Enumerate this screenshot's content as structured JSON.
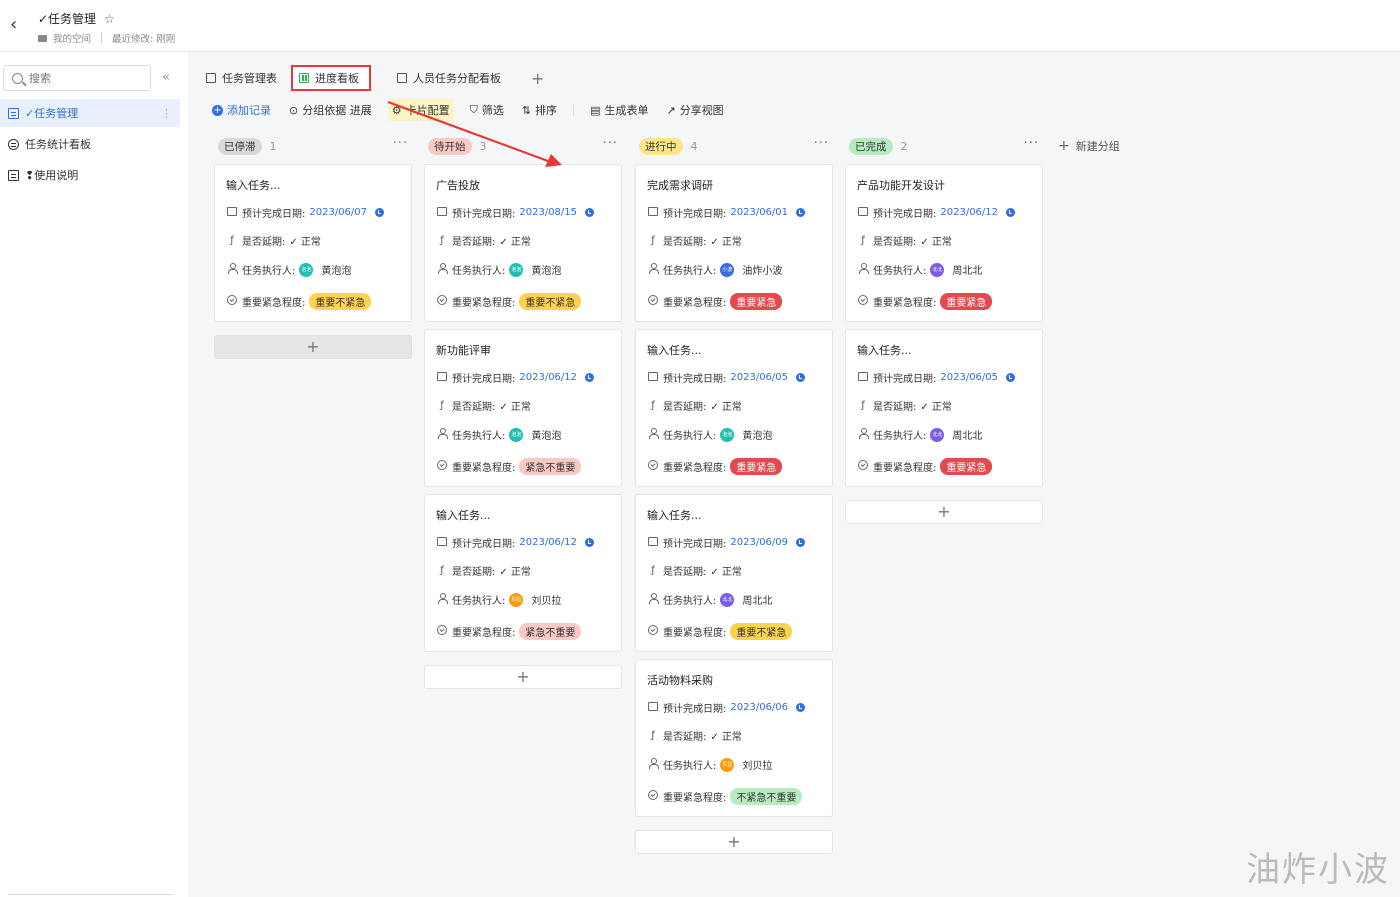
{
  "header": {
    "back": "‹",
    "title": "✓任务管理",
    "star": "☆",
    "space": "我的空间",
    "modified": "最近修改: 刚刚"
  },
  "sidebar": {
    "search_placeholder": "搜索",
    "collapse": "«",
    "items": [
      {
        "label": "✓任务管理",
        "icon": "table-icon",
        "active": true
      },
      {
        "label": "任务统计看板",
        "icon": "dashboard-icon",
        "active": false
      },
      {
        "label": "❢使用说明",
        "icon": "doc-icon",
        "active": false
      }
    ],
    "more": "⋮"
  },
  "tabs": [
    {
      "label": "任务管理表",
      "icon": "table-icon",
      "active": false
    },
    {
      "label": "进度看板",
      "icon": "kanban-icon",
      "active": true
    },
    {
      "label": "人员任务分配看板",
      "icon": "kanban-icon",
      "active": false
    }
  ],
  "tab_add": "+",
  "toolbar": {
    "add_record": "添加记录",
    "group_by": "分组依据 进展",
    "card_config": "卡片配置",
    "filter": "筛选",
    "sort": "排序",
    "form": "生成表单",
    "share": "分享视图"
  },
  "new_group": "新建分组",
  "field_labels": {
    "date": "预计完成日期:",
    "delay": "是否延期:",
    "owner": "任务执行人:",
    "priority": "重要紧急程度:"
  },
  "colors": {
    "accent": "#2f6de1",
    "annotation": "#e53935"
  },
  "columns": [
    {
      "status": "已停滞",
      "count": "1",
      "bg": "#d9d9d9",
      "fg": "#333",
      "cards": [
        {
          "title": "输入任务...",
          "date": "2023/06/07",
          "delay": "✓ 正常",
          "owner": "黄泡泡",
          "owner_short": "泡泡",
          "owner_color": "#1fc0b2",
          "priority": "重要不紧急",
          "pri_bg": "#fcd34d",
          "pri_fg": "#333"
        }
      ],
      "add": "+"
    },
    {
      "status": "待开始",
      "count": "3",
      "bg": "#f9c9c6",
      "fg": "#333",
      "cards": [
        {
          "title": "广告投放",
          "date": "2023/08/15",
          "delay": "✓ 正常",
          "owner": "黄泡泡",
          "owner_short": "泡泡",
          "owner_color": "#1fc0b2",
          "priority": "重要不紧急",
          "pri_bg": "#fcd34d",
          "pri_fg": "#333"
        },
        {
          "title": "新功能评审",
          "date": "2023/06/12",
          "delay": "✓ 正常",
          "owner": "黄泡泡",
          "owner_short": "泡泡",
          "owner_color": "#1fc0b2",
          "priority": "紧急不重要",
          "pri_bg": "#f9c9c6",
          "pri_fg": "#333"
        },
        {
          "title": "输入任务...",
          "date": "2023/06/12",
          "delay": "✓ 正常",
          "owner": "刘贝拉",
          "owner_short": "贝拉",
          "owner_color": "#f59e0b",
          "priority": "紧急不重要",
          "pri_bg": "#f9c9c6",
          "pri_fg": "#333"
        }
      ],
      "add": "+"
    },
    {
      "status": "进行中",
      "count": "4",
      "bg": "#fde68a",
      "fg": "#333",
      "cards": [
        {
          "title": "完成需求调研",
          "date": "2023/06/01",
          "delay": "✓ 正常",
          "owner": "油炸小波",
          "owner_short": "小波",
          "owner_color": "#3b6de0",
          "priority": "重要紧急",
          "pri_bg": "#e5484d",
          "pri_fg": "#fff"
        },
        {
          "title": "输入任务...",
          "date": "2023/06/05",
          "delay": "✓ 正常",
          "owner": "黄泡泡",
          "owner_short": "泡泡",
          "owner_color": "#1fc0b2",
          "priority": "重要紧急",
          "pri_bg": "#e5484d",
          "pri_fg": "#fff"
        },
        {
          "title": "输入任务...",
          "date": "2023/06/09",
          "delay": "✓ 正常",
          "owner": "周北北",
          "owner_short": "北北",
          "owner_color": "#7c5ce0",
          "priority": "重要不紧急",
          "pri_bg": "#fcd34d",
          "pri_fg": "#333"
        },
        {
          "title": "活动物料采购",
          "date": "2023/06/06",
          "delay": "✓ 正常",
          "owner": "刘贝拉",
          "owner_short": "贝拉",
          "owner_color": "#f59e0b",
          "priority": "不紧急不重要",
          "pri_bg": "#b7ebc0",
          "pri_fg": "#333"
        }
      ],
      "add": "+"
    },
    {
      "status": "已完成",
      "count": "2",
      "bg": "#b7ebc0",
      "fg": "#333",
      "cards": [
        {
          "title": "产品功能开发设计",
          "date": "2023/06/12",
          "delay": "✓ 正常",
          "owner": "周北北",
          "owner_short": "北北",
          "owner_color": "#7c5ce0",
          "priority": "重要紧急",
          "pri_bg": "#e5484d",
          "pri_fg": "#fff"
        },
        {
          "title": "输入任务...",
          "date": "2023/06/05",
          "delay": "✓ 正常",
          "owner": "周北北",
          "owner_short": "北北",
          "owner_color": "#7c5ce0",
          "priority": "重要紧急",
          "pri_bg": "#e5484d",
          "pri_fg": "#fff"
        }
      ],
      "add": "+"
    }
  ],
  "watermark": "油炸小波"
}
